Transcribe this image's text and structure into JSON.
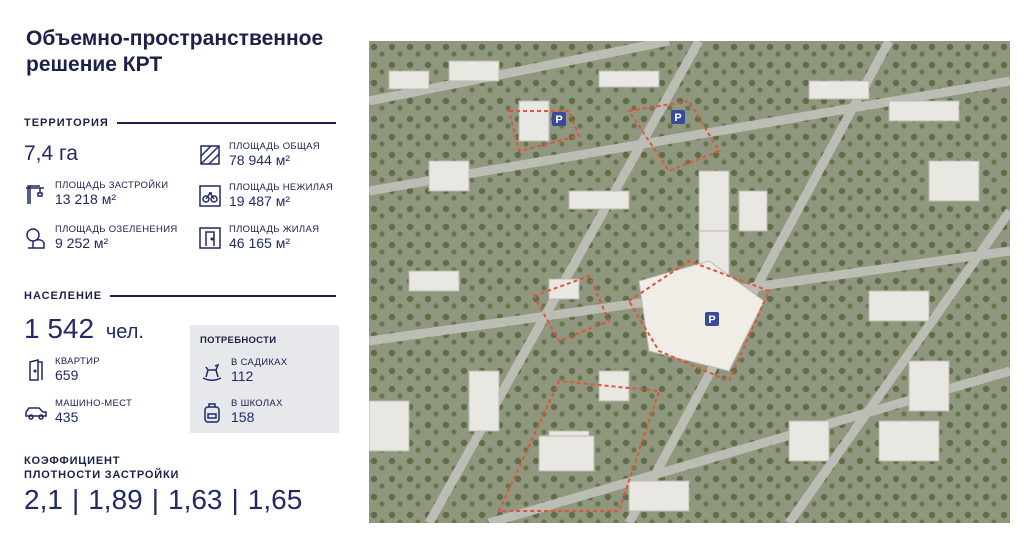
{
  "title": "Объемно-пространственное решение КРТ",
  "territory": {
    "header": "ТЕРРИТОРИЯ",
    "area": "7,4 га",
    "built_label": "ПЛОЩАДЬ ЗАСТРОЙКИ",
    "built_value": "13 218 м²",
    "green_label": "ПЛОЩАДЬ ОЗЕЛЕНЕНИЯ",
    "green_value": "9 252 м²",
    "total_label": "ПЛОЩАДЬ ОБЩАЯ",
    "total_value": "78 944 м²",
    "nonres_label": "ПЛОЩАДЬ НЕЖИЛАЯ",
    "nonres_value": "19 487 м²",
    "res_label": "ПЛОЩАДЬ ЖИЛАЯ",
    "res_value": "46 165 м²"
  },
  "population": {
    "header": "НАСЕЛЕНИЕ",
    "count": "1 542",
    "unit": "чел.",
    "apartments_label": "КВАРТИР",
    "apartments_value": "659",
    "parking_label": "МАШИНО-МЕСТ",
    "parking_value": "435"
  },
  "needs": {
    "header": "ПОТРЕБНОСТИ",
    "kindergarten_label": "В САДИКАХ",
    "kindergarten_value": "112",
    "school_label": "В ШКОЛАХ",
    "school_value": "158"
  },
  "density": {
    "line1": "КОЭФФИЦИЕНТ",
    "line2": "ПЛОТНОСТИ ЗАСТРОЙКИ",
    "values": [
      "2,1",
      "1,89",
      "1,63",
      "1,65"
    ],
    "separator": "|"
  },
  "map": {
    "parking_marker": "P",
    "boundary_color": "#e0533d",
    "marker_color": "#3a4a9a"
  }
}
